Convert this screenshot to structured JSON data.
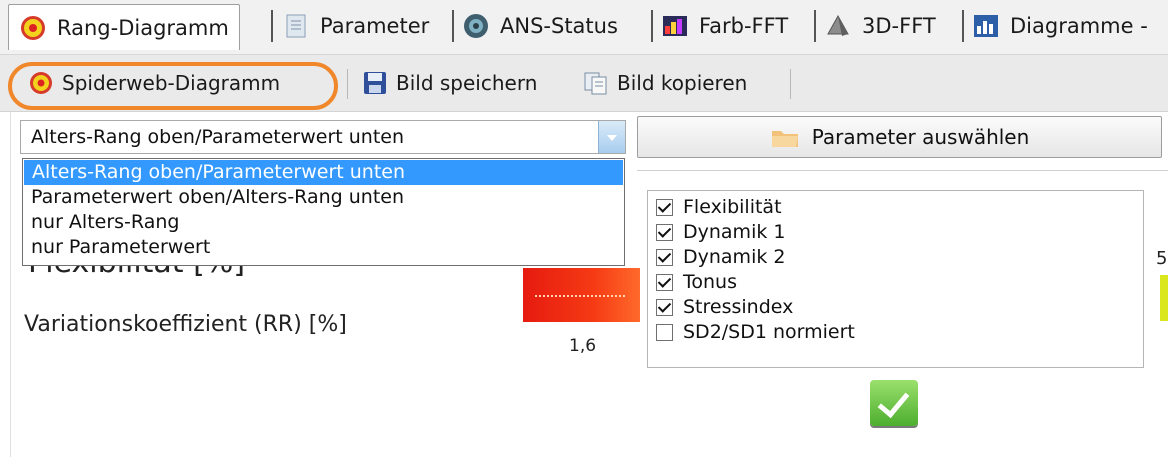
{
  "tabs": [
    {
      "label": "Rang-Diagramm",
      "icon": "target-icon",
      "active": true
    },
    {
      "label": "Parameter",
      "icon": "document-icon",
      "active": false
    },
    {
      "label": "ANS-Status",
      "icon": "status-disc-icon",
      "active": false
    },
    {
      "label": "Farb-FFT",
      "icon": "color-chart-icon",
      "active": false
    },
    {
      "label": "3D-FFT",
      "icon": "3d-shape-icon",
      "active": false
    },
    {
      "label": "Diagramme -",
      "icon": "bar-chart-icon",
      "active": false
    }
  ],
  "toolbar": {
    "spiderweb_label": "Spiderweb-Diagramm",
    "save_label": "Bild speichern",
    "copy_label": "Bild kopieren"
  },
  "combo": {
    "selected": "Alters-Rang oben/Parameterwert unten",
    "options": [
      "Alters-Rang oben/Parameterwert unten",
      "Parameterwert oben/Alters-Rang unten",
      "nur Alters-Rang",
      "nur Parameterwert"
    ]
  },
  "param_button_label": "Parameter auswählen",
  "chart": {
    "row1_label": "Flexibilität [%]",
    "row2_label": "Variationskoeffizient (RR) [%]",
    "bar_value": "1,6",
    "edge_value": "5"
  },
  "checklist": [
    {
      "label": "Flexibilität",
      "checked": true
    },
    {
      "label": "Dynamik 1",
      "checked": true
    },
    {
      "label": "Dynamik 2",
      "checked": true
    },
    {
      "label": "Tonus",
      "checked": true
    },
    {
      "label": "Stressindex",
      "checked": true
    },
    {
      "label": "SD2/SD1 normiert",
      "checked": false
    }
  ],
  "colors": {
    "highlight": "#f0872b",
    "selection": "#3399ff",
    "bar_red": "#e61b10",
    "ok_green": "#4cae2e"
  }
}
